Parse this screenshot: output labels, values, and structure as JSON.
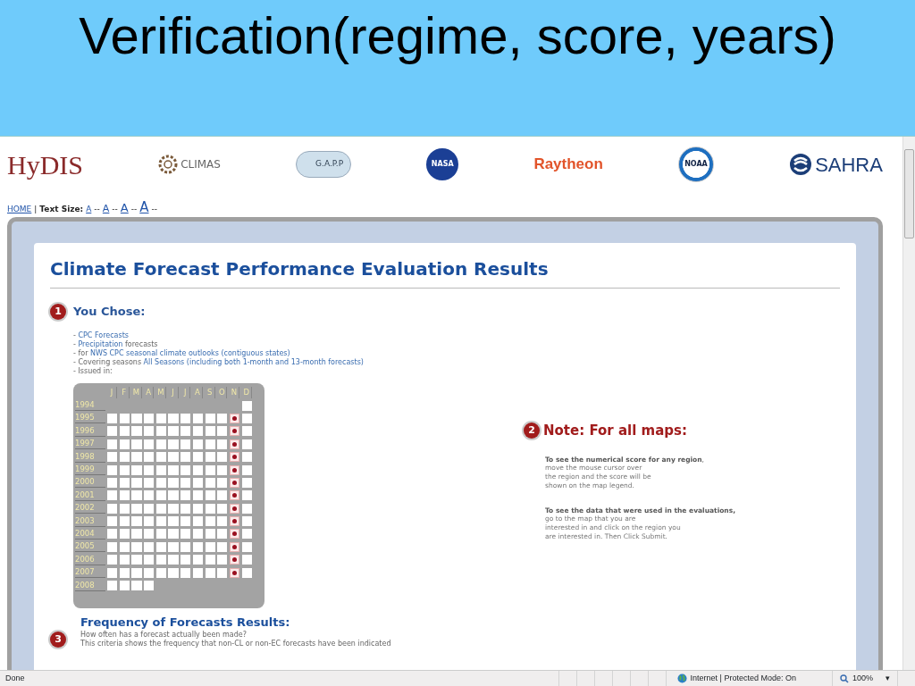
{
  "slide": {
    "title": "Verification(regime, score, years)"
  },
  "logos": [
    {
      "kind": "hydis",
      "text": "HyDIS"
    },
    {
      "kind": "climas",
      "text": "CLIMAS"
    },
    {
      "kind": "gapp",
      "text": "G.A.P.P"
    },
    {
      "kind": "nasa",
      "text": "NASA"
    },
    {
      "kind": "raytheon",
      "text": "Raytheon"
    },
    {
      "kind": "noaa",
      "text": "NOAA"
    },
    {
      "kind": "sahra",
      "text": "SAHRA"
    }
  ],
  "nav": {
    "home": "HOME",
    "separator": "|",
    "label": "Text Size:",
    "sizes": [
      "A",
      "A",
      "A",
      "A"
    ],
    "dash": "--"
  },
  "page_title": "Climate Forecast Performance Evaluation Results",
  "chose": {
    "number": "1",
    "heading": "You Chose:",
    "lines": [
      [
        {
          "kind": "plain",
          "text": "- "
        },
        {
          "kind": "value",
          "text": "CPC Forecasts"
        }
      ],
      [
        {
          "kind": "plain",
          "text": "- "
        },
        {
          "kind": "value",
          "text": "Precipitation"
        },
        {
          "kind": "plain",
          "text": " forecasts"
        }
      ],
      [
        {
          "kind": "plain",
          "text": "- for "
        },
        {
          "kind": "value",
          "text": "NWS CPC seasonal climate outlooks (contiguous states)"
        }
      ],
      [
        {
          "kind": "plain",
          "text": "- Covering seasons "
        },
        {
          "kind": "value",
          "text": "All Seasons (including both 1-month and 13-month forecasts)"
        }
      ],
      [
        {
          "kind": "plain",
          "text": "- Issued in:"
        }
      ]
    ]
  },
  "grid": {
    "months": [
      "J",
      "F",
      "M",
      "A",
      "M",
      "J",
      "J",
      "A",
      "S",
      "O",
      "N",
      "D"
    ],
    "rows": [
      {
        "year": "1994",
        "cells": [
          {
            "kind": "blank"
          },
          {
            "kind": "blank"
          },
          {
            "kind": "blank"
          },
          {
            "kind": "blank"
          },
          {
            "kind": "blank"
          },
          {
            "kind": "blank"
          },
          {
            "kind": "blank"
          },
          {
            "kind": "blank"
          },
          {
            "kind": "blank"
          },
          {
            "kind": "blank"
          },
          {
            "kind": "blank"
          },
          {
            "kind": "box",
            "selected": false
          }
        ]
      },
      {
        "year": "1995",
        "cells": [
          {
            "kind": "box",
            "selected": false
          },
          {
            "kind": "box",
            "selected": false
          },
          {
            "kind": "box",
            "selected": false
          },
          {
            "kind": "box",
            "selected": false
          },
          {
            "kind": "box",
            "selected": false
          },
          {
            "kind": "box",
            "selected": false
          },
          {
            "kind": "box",
            "selected": false
          },
          {
            "kind": "box",
            "selected": false
          },
          {
            "kind": "box",
            "selected": false
          },
          {
            "kind": "box",
            "selected": false
          },
          {
            "kind": "box",
            "selected": true
          },
          {
            "kind": "box",
            "selected": false
          }
        ]
      },
      {
        "year": "1996",
        "cells": [
          {
            "kind": "box",
            "selected": false
          },
          {
            "kind": "box",
            "selected": false
          },
          {
            "kind": "box",
            "selected": false
          },
          {
            "kind": "box",
            "selected": false
          },
          {
            "kind": "box",
            "selected": false
          },
          {
            "kind": "box",
            "selected": false
          },
          {
            "kind": "box",
            "selected": false
          },
          {
            "kind": "box",
            "selected": false
          },
          {
            "kind": "box",
            "selected": false
          },
          {
            "kind": "box",
            "selected": false
          },
          {
            "kind": "box",
            "selected": true
          },
          {
            "kind": "box",
            "selected": false
          }
        ]
      },
      {
        "year": "1997",
        "cells": [
          {
            "kind": "box",
            "selected": false
          },
          {
            "kind": "box",
            "selected": false
          },
          {
            "kind": "box",
            "selected": false
          },
          {
            "kind": "box",
            "selected": false
          },
          {
            "kind": "box",
            "selected": false
          },
          {
            "kind": "box",
            "selected": false
          },
          {
            "kind": "box",
            "selected": false
          },
          {
            "kind": "box",
            "selected": false
          },
          {
            "kind": "box",
            "selected": false
          },
          {
            "kind": "box",
            "selected": false
          },
          {
            "kind": "box",
            "selected": true
          },
          {
            "kind": "box",
            "selected": false
          }
        ]
      },
      {
        "year": "1998",
        "cells": [
          {
            "kind": "box",
            "selected": false
          },
          {
            "kind": "box",
            "selected": false
          },
          {
            "kind": "box",
            "selected": false
          },
          {
            "kind": "box",
            "selected": false
          },
          {
            "kind": "box",
            "selected": false
          },
          {
            "kind": "box",
            "selected": false
          },
          {
            "kind": "box",
            "selected": false
          },
          {
            "kind": "box",
            "selected": false
          },
          {
            "kind": "box",
            "selected": false
          },
          {
            "kind": "box",
            "selected": false
          },
          {
            "kind": "box",
            "selected": true
          },
          {
            "kind": "box",
            "selected": false
          }
        ]
      },
      {
        "year": "1999",
        "cells": [
          {
            "kind": "box",
            "selected": false
          },
          {
            "kind": "box",
            "selected": false
          },
          {
            "kind": "box",
            "selected": false
          },
          {
            "kind": "box",
            "selected": false
          },
          {
            "kind": "box",
            "selected": false
          },
          {
            "kind": "box",
            "selected": false
          },
          {
            "kind": "box",
            "selected": false
          },
          {
            "kind": "box",
            "selected": false
          },
          {
            "kind": "box",
            "selected": false
          },
          {
            "kind": "box",
            "selected": false
          },
          {
            "kind": "box",
            "selected": true
          },
          {
            "kind": "box",
            "selected": false
          }
        ]
      },
      {
        "year": "2000",
        "cells": [
          {
            "kind": "box",
            "selected": false
          },
          {
            "kind": "box",
            "selected": false
          },
          {
            "kind": "box",
            "selected": false
          },
          {
            "kind": "box",
            "selected": false
          },
          {
            "kind": "box",
            "selected": false
          },
          {
            "kind": "box",
            "selected": false
          },
          {
            "kind": "box",
            "selected": false
          },
          {
            "kind": "box",
            "selected": false
          },
          {
            "kind": "box",
            "selected": false
          },
          {
            "kind": "box",
            "selected": false
          },
          {
            "kind": "box",
            "selected": true
          },
          {
            "kind": "box",
            "selected": false
          }
        ]
      },
      {
        "year": "2001",
        "cells": [
          {
            "kind": "box",
            "selected": false
          },
          {
            "kind": "box",
            "selected": false
          },
          {
            "kind": "box",
            "selected": false
          },
          {
            "kind": "box",
            "selected": false
          },
          {
            "kind": "box",
            "selected": false
          },
          {
            "kind": "box",
            "selected": false
          },
          {
            "kind": "box",
            "selected": false
          },
          {
            "kind": "box",
            "selected": false
          },
          {
            "kind": "box",
            "selected": false
          },
          {
            "kind": "box",
            "selected": false
          },
          {
            "kind": "box",
            "selected": true
          },
          {
            "kind": "box",
            "selected": false
          }
        ]
      },
      {
        "year": "2002",
        "cells": [
          {
            "kind": "box",
            "selected": false
          },
          {
            "kind": "box",
            "selected": false
          },
          {
            "kind": "box",
            "selected": false
          },
          {
            "kind": "box",
            "selected": false
          },
          {
            "kind": "box",
            "selected": false
          },
          {
            "kind": "box",
            "selected": false
          },
          {
            "kind": "box",
            "selected": false
          },
          {
            "kind": "box",
            "selected": false
          },
          {
            "kind": "box",
            "selected": false
          },
          {
            "kind": "box",
            "selected": false
          },
          {
            "kind": "box",
            "selected": true
          },
          {
            "kind": "box",
            "selected": false
          }
        ]
      },
      {
        "year": "2003",
        "cells": [
          {
            "kind": "box",
            "selected": false
          },
          {
            "kind": "box",
            "selected": false
          },
          {
            "kind": "box",
            "selected": false
          },
          {
            "kind": "box",
            "selected": false
          },
          {
            "kind": "box",
            "selected": false
          },
          {
            "kind": "box",
            "selected": false
          },
          {
            "kind": "box",
            "selected": false
          },
          {
            "kind": "box",
            "selected": false
          },
          {
            "kind": "box",
            "selected": false
          },
          {
            "kind": "box",
            "selected": false
          },
          {
            "kind": "box",
            "selected": true
          },
          {
            "kind": "box",
            "selected": false
          }
        ]
      },
      {
        "year": "2004",
        "cells": [
          {
            "kind": "box",
            "selected": false
          },
          {
            "kind": "box",
            "selected": false
          },
          {
            "kind": "box",
            "selected": false
          },
          {
            "kind": "box",
            "selected": false
          },
          {
            "kind": "box",
            "selected": false
          },
          {
            "kind": "box",
            "selected": false
          },
          {
            "kind": "box",
            "selected": false
          },
          {
            "kind": "box",
            "selected": false
          },
          {
            "kind": "box",
            "selected": false
          },
          {
            "kind": "box",
            "selected": false
          },
          {
            "kind": "box",
            "selected": true
          },
          {
            "kind": "box",
            "selected": false
          }
        ]
      },
      {
        "year": "2005",
        "cells": [
          {
            "kind": "box",
            "selected": false
          },
          {
            "kind": "box",
            "selected": false
          },
          {
            "kind": "box",
            "selected": false
          },
          {
            "kind": "box",
            "selected": false
          },
          {
            "kind": "box",
            "selected": false
          },
          {
            "kind": "box",
            "selected": false
          },
          {
            "kind": "box",
            "selected": false
          },
          {
            "kind": "box",
            "selected": false
          },
          {
            "kind": "box",
            "selected": false
          },
          {
            "kind": "box",
            "selected": false
          },
          {
            "kind": "box",
            "selected": true
          },
          {
            "kind": "box",
            "selected": false
          }
        ]
      },
      {
        "year": "2006",
        "cells": [
          {
            "kind": "box",
            "selected": false
          },
          {
            "kind": "box",
            "selected": false
          },
          {
            "kind": "box",
            "selected": false
          },
          {
            "kind": "box",
            "selected": false
          },
          {
            "kind": "box",
            "selected": false
          },
          {
            "kind": "box",
            "selected": false
          },
          {
            "kind": "box",
            "selected": false
          },
          {
            "kind": "box",
            "selected": false
          },
          {
            "kind": "box",
            "selected": false
          },
          {
            "kind": "box",
            "selected": false
          },
          {
            "kind": "box",
            "selected": true
          },
          {
            "kind": "box",
            "selected": false
          }
        ]
      },
      {
        "year": "2007",
        "cells": [
          {
            "kind": "box",
            "selected": false
          },
          {
            "kind": "box",
            "selected": false
          },
          {
            "kind": "box",
            "selected": false
          },
          {
            "kind": "box",
            "selected": false
          },
          {
            "kind": "box",
            "selected": false
          },
          {
            "kind": "box",
            "selected": false
          },
          {
            "kind": "box",
            "selected": false
          },
          {
            "kind": "box",
            "selected": false
          },
          {
            "kind": "box",
            "selected": false
          },
          {
            "kind": "box",
            "selected": false
          },
          {
            "kind": "box",
            "selected": true
          },
          {
            "kind": "box",
            "selected": false
          }
        ]
      },
      {
        "year": "2008",
        "cells": [
          {
            "kind": "box",
            "selected": false
          },
          {
            "kind": "box",
            "selected": false
          },
          {
            "kind": "box",
            "selected": false
          },
          {
            "kind": "box",
            "selected": false
          },
          {
            "kind": "blank"
          },
          {
            "kind": "blank"
          },
          {
            "kind": "blank"
          },
          {
            "kind": "blank"
          },
          {
            "kind": "blank"
          },
          {
            "kind": "blank"
          },
          {
            "kind": "blank"
          },
          {
            "kind": "blank"
          }
        ]
      }
    ]
  },
  "note": {
    "number": "2",
    "heading": "Note: For all maps:",
    "paragraphs": [
      [
        "**To see the numerical score for any region**,",
        "move the mouse cursor over",
        "the region and the score will be",
        "shown on the map legend."
      ],
      [
        "**To see the data that were used in the evaluations,**",
        "go to the map that you are",
        "interested in and click on the region you",
        "are interested in. Then Click Submit."
      ]
    ]
  },
  "frequency": {
    "number": "3",
    "heading": "Frequency of Forecasts Results:",
    "lines": [
      "How often has a forecast actually been made?",
      "This criteria shows the frequency that non-CL or non-EC forecasts have been indicated"
    ]
  },
  "status_bar": {
    "text": "Done",
    "zone": "Internet | Protected Mode: On",
    "zoom": "100%",
    "caret": "▾"
  }
}
